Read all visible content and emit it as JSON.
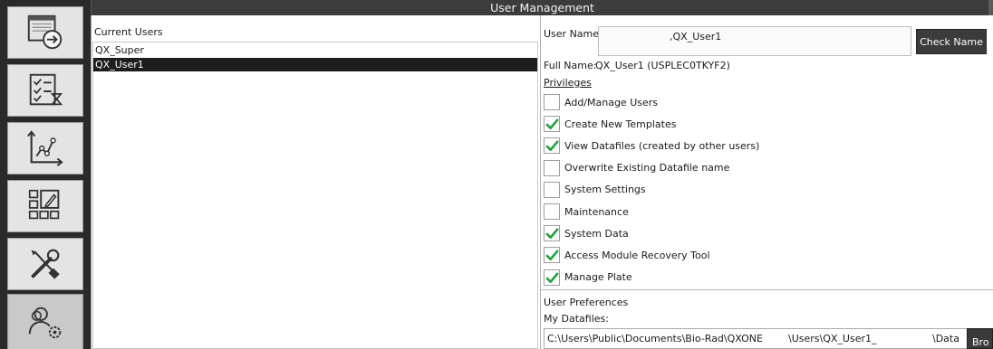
{
  "window": {
    "title": "User Management"
  },
  "nav": {
    "items": [
      {
        "icon": "export-arrow-icon"
      },
      {
        "icon": "checklist-hourglass-icon"
      },
      {
        "icon": "line-chart-icon"
      },
      {
        "icon": "plate-edit-icon"
      },
      {
        "icon": "tools-icon"
      },
      {
        "icon": "user-settings-icon"
      }
    ]
  },
  "users": {
    "header": "Current Users",
    "items": [
      "QX_Super",
      "QX_User1"
    ],
    "selected": "QX_User1"
  },
  "details": {
    "username_label": "User Name:",
    "username_value": ",QX_User1",
    "check_name_label": "Check Name",
    "fullname_label": "Full Name:",
    "fullname_value": "QX_User1 (USPLEC0TKYF2)",
    "privileges_header": "Privileges",
    "privileges": [
      {
        "label": "Add/Manage Users",
        "checked": false
      },
      {
        "label": "Create New Templates",
        "checked": true
      },
      {
        "label": "View Datafiles (created by other users)",
        "checked": true
      },
      {
        "label": "Overwrite Existing Datafile name",
        "checked": false
      },
      {
        "label": "System Settings",
        "checked": false
      },
      {
        "label": "Maintenance",
        "checked": false
      },
      {
        "label": "System Data",
        "checked": true
      },
      {
        "label": "Access Module Recovery Tool",
        "checked": true
      },
      {
        "label": "Manage Plate",
        "checked": true
      }
    ]
  },
  "preferences": {
    "header": "User Preferences",
    "datafiles_label": "My Datafiles:",
    "path_part1": "C:\\Users\\Public\\Documents\\Bio-Rad\\QXONE",
    "path_part2": "\\Users\\QX_User1_",
    "path_part3": "\\Data",
    "browse_label": "Bro"
  },
  "colors": {
    "check": "#1fa33a",
    "selected_row": "#1d1d1d",
    "nav_bg": "#2a2a2a",
    "button_bg": "#3b3b3b"
  }
}
